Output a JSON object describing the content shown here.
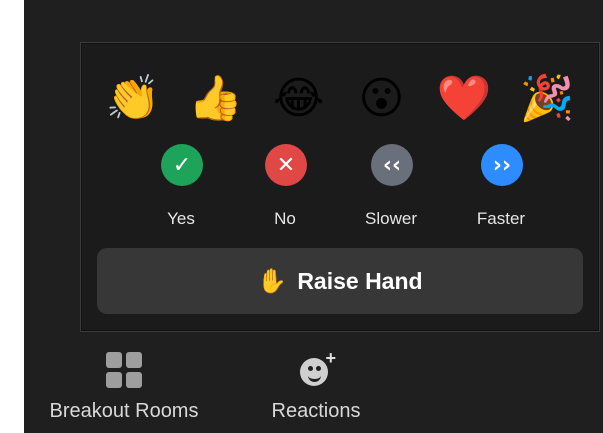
{
  "reactions_popup": {
    "emojis": [
      {
        "name": "clap-emoji",
        "glyph": "👏"
      },
      {
        "name": "thumbs-up-emoji",
        "glyph": "👍"
      },
      {
        "name": "tears-of-joy-emoji",
        "glyph": "😂"
      },
      {
        "name": "surprised-emoji",
        "glyph": "😮"
      },
      {
        "name": "heart-emoji",
        "glyph": "❤️"
      },
      {
        "name": "party-popper-emoji",
        "glyph": "🎉"
      }
    ],
    "feedback": [
      {
        "label": "Yes",
        "glyph": "✓",
        "color": "#1ea35a"
      },
      {
        "label": "No",
        "glyph": "✕",
        "color": "#e04846"
      },
      {
        "label": "Slower",
        "glyph": "‹‹",
        "color": "#6a6f7c"
      },
      {
        "label": "Faster",
        "glyph": "››",
        "color": "#2d8cff"
      }
    ],
    "raise_hand": {
      "glyph": "✋",
      "label": "Raise Hand"
    }
  },
  "toolbar": {
    "breakout_rooms_label": "Breakout Rooms",
    "reactions_label": "Reactions"
  }
}
